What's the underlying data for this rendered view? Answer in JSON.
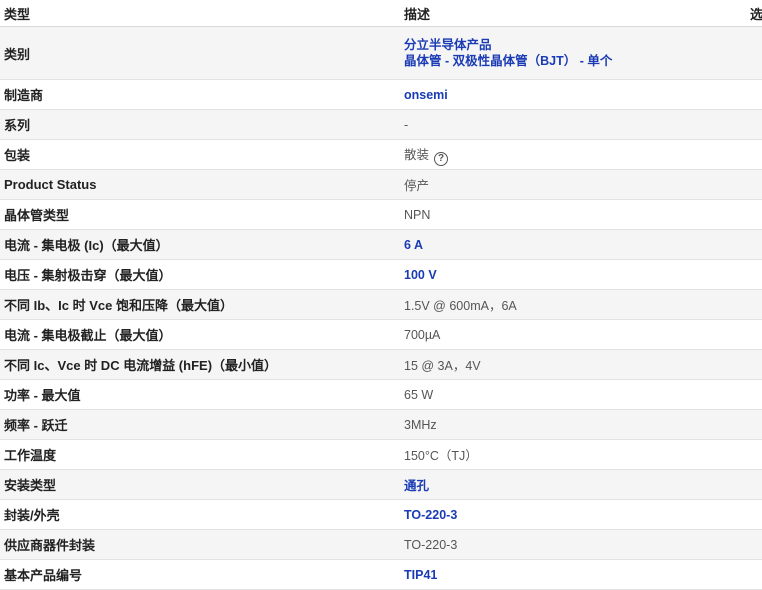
{
  "header": {
    "type": "类型",
    "desc": "描述",
    "select": "选"
  },
  "rows": {
    "category": {
      "label": "类别",
      "values": [
        "分立半导体产品",
        "晶体管 - 双极性晶体管（BJT） - 单个"
      ]
    },
    "manufacturer": {
      "label": "制造商",
      "value": "onsemi"
    },
    "series": {
      "label": "系列",
      "value": "-"
    },
    "package": {
      "label": "包装",
      "value": "散装"
    },
    "product_status": {
      "label": "Product Status",
      "value": "停产"
    },
    "transistor_type": {
      "label": "晶体管类型",
      "value": "NPN"
    },
    "ic_max": {
      "label": "电流 - 集电极 (Ic)（最大值）",
      "value": "6 A"
    },
    "vce_breakdown": {
      "label": "电压 - 集射极击穿（最大值）",
      "value": "100 V"
    },
    "vce_sat": {
      "label": "不同 Ib、Ic 时 Vce 饱和压降（最大值）",
      "value": "1.5V @ 600mA，6A"
    },
    "icbo": {
      "label": "电流 - 集电极截止（最大值）",
      "value": "700µA"
    },
    "hfe": {
      "label": "不同 Ic、Vce 时 DC 电流增益 (hFE)（最小值）",
      "value": "15 @ 3A，4V"
    },
    "power": {
      "label": "功率 - 最大值",
      "value": "65 W"
    },
    "frequency": {
      "label": "频率 - 跃迁",
      "value": "3MHz"
    },
    "temp": {
      "label": "工作温度",
      "value": "150°C（TJ）"
    },
    "mount": {
      "label": "安装类型",
      "value": "通孔"
    },
    "case": {
      "label": "封装/外壳",
      "value": "TO-220-3"
    },
    "supplier_pkg": {
      "label": "供应商器件封装",
      "value": "TO-220-3"
    },
    "base_part": {
      "label": "基本产品编号",
      "value": "TIP41"
    }
  },
  "icons": {
    "help": "question-circle-icon",
    "help_glyph": "?"
  },
  "colors": {
    "link": "#1a3bb5",
    "stripe": "#f5f5f5"
  }
}
